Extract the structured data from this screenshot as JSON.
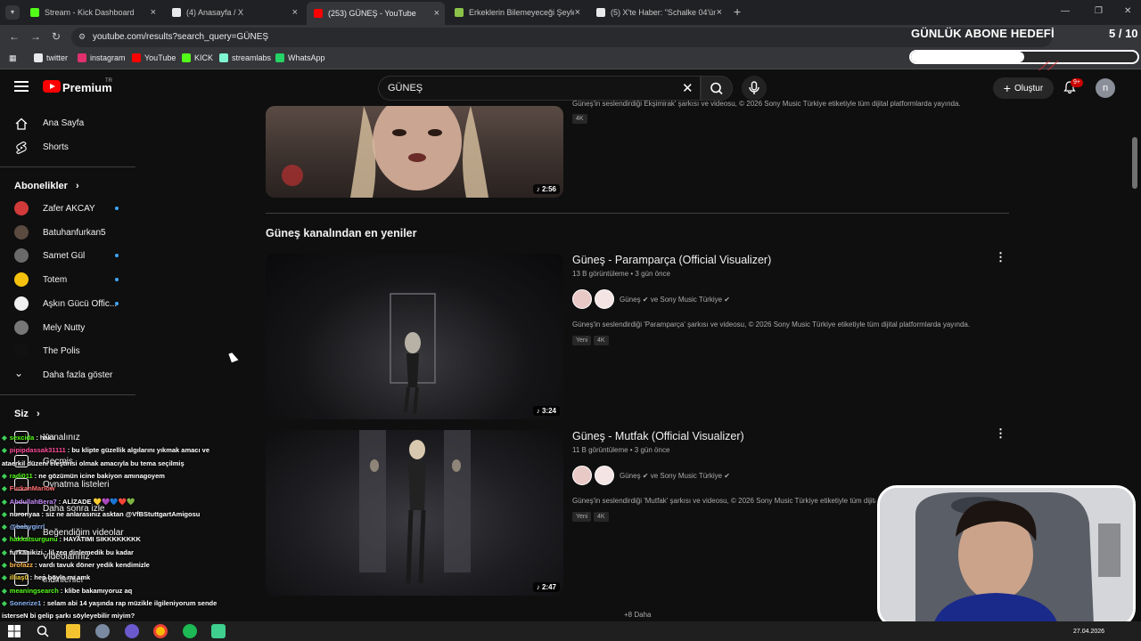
{
  "browser": {
    "tabs": [
      {
        "title": "Stream - Kick Dashboard",
        "favicon_color": "#53fc18",
        "active": false
      },
      {
        "title": "(4) Anasayfa / X",
        "favicon_color": "#e7e9ea",
        "active": false
      },
      {
        "title": "(253) GÜNEŞ - YouTube",
        "favicon_color": "#ff0000",
        "active": true
      },
      {
        "title": "Erkeklerin Bilemeyeceği Şeyler",
        "favicon_color": "#8bc34a",
        "active": false
      },
      {
        "title": "(5) X'te Haber: \"Schalke 04'ün s",
        "favicon_color": "#e7e9ea",
        "active": false
      }
    ],
    "new_tab_label": "+",
    "close_glyph": "×",
    "url": "youtube.com/results?search_query=GÜNEŞ",
    "bookmarks": [
      {
        "label": "twitter",
        "color": "#e7e9ea"
      },
      {
        "label": "instagram",
        "color": "#e1306c"
      },
      {
        "label": "YouTube",
        "color": "#ff0000"
      },
      {
        "label": "KICK",
        "color": "#53fc18"
      },
      {
        "label": "streamlabs",
        "color": "#80f5d2"
      },
      {
        "label": "WhatsApp",
        "color": "#25d366"
      }
    ]
  },
  "overlay": {
    "goal_title": "GÜNLÜK ABONE HEDEFİ",
    "goal_count": "5 / 10",
    "goal_progress": 0.5
  },
  "header": {
    "brand": "Premium",
    "region": "TR",
    "search_value": "GÜNEŞ",
    "create_label": "Oluştur",
    "notifications": "9+",
    "avatar_letter": "n"
  },
  "sidebar": {
    "nav": [
      {
        "label": "Ana Sayfa",
        "icon": "home-icon"
      },
      {
        "label": "Shorts",
        "icon": "shorts-icon"
      }
    ],
    "subs_header": "Abonelikler",
    "subscriptions": [
      {
        "label": "Zafer AKCAY",
        "color": "#d23a3a",
        "live": true
      },
      {
        "label": "Batuhanfurkan5",
        "color": "#5a4a40",
        "live": false
      },
      {
        "label": "Samet Gül",
        "color": "#6a6a6a",
        "live": true
      },
      {
        "label": "Totem",
        "color": "#f4c20d",
        "live": true
      },
      {
        "label": "Aşkın Gücü Offic...",
        "color": "#f0f0f0",
        "live": true
      },
      {
        "label": "Mely Nutty",
        "color": "#777777",
        "live": false
      },
      {
        "label": "The Polis",
        "color": "#111111",
        "live": false
      }
    ],
    "show_more": "Daha fazla göster",
    "you_header": "Siz",
    "you_items": [
      "Kanalınız",
      "Geçmiş",
      "Oynatma listeleri",
      "Daha sonra izle",
      "Beğendiğim videolar",
      "Videolarınız",
      "İndirilenler"
    ]
  },
  "results": {
    "top_card": {
      "duration": "2:56",
      "desc": "Güneş'in seslendirdiği  Ekşimirak' şarkısı ve videosu, © 2026 Sony Music Türkiye etiketiyle tüm dijital platformlarda yayında.",
      "badges": [
        "4K"
      ]
    },
    "section_title": "Güneş kanalından en yeniler",
    "videos": [
      {
        "title": "Güneş - Paramparça (Official Visualizer)",
        "meta": "13 B görüntüleme • 3 gün önce",
        "channel": "Güneş  ✔ ve Sony Music Türkiye ✔",
        "desc": "Güneş'in seslendirdiği 'Paramparça' şarkısı ve videosu, © 2026 Sony Music Türkiye etiketiyle tüm dijital platformlarda yayında.",
        "badges": [
          "Yeni",
          "4K"
        ],
        "duration": "3:24"
      },
      {
        "title": "Güneş - Mutfak (Official Visualizer)",
        "meta": "11 B görüntüleme • 3 gün önce",
        "channel": "Güneş  ✔ ve Sony Music Türkiye ✔",
        "desc": "Güneş'in seslendirdiği 'Mutfak' şarkısı ve videosu, © 2026 Sony Music Türkiye etiketiyle tüm dijital platformlarda yayında.",
        "badges": [
          "Yeni",
          "4K"
        ],
        "duration": "2:47"
      }
    ],
    "more_label": "+8 Daha"
  },
  "chat": [
    {
      "user": "sexcida",
      "user_color": "#53fc18",
      "msg": "haklı"
    },
    {
      "user": "pipipdassak31111",
      "user_color": "#ff4d9a",
      "msg": "bu klipte güzellik algılarını yıkmak amacı ve"
    },
    {
      "user": "",
      "user_color": "#ffffff",
      "msg": "ataerkil düzeni eleştirisi olmak amacıyla bu tema seçilmiş"
    },
    {
      "user": "radi011",
      "user_color": "#53fc18",
      "msg": "ne gözümün icine bakiyon amınagoyem"
    },
    {
      "user": "FurkanMarlow",
      "user_color": "#ff6b6b",
      "msg": ""
    },
    {
      "user": "AbdullahBera7",
      "user_color": "#c58af9",
      "msg": "ALİZADE 💛💜💙❤️💚"
    },
    {
      "user": "nuronyaa",
      "user_color": "#ffffff",
      "msg": "siz ne anlarasınız asktan @VfBStuttgartAmigosu"
    },
    {
      "user": "@babygirrl",
      "user_color": "#8ab4f8",
      "msg": ""
    },
    {
      "user": "hakkatsurgunu",
      "user_color": "#53fc18",
      "msg": "HAYATIMI SIKKKKKKKK"
    },
    {
      "user": "furkanikizi",
      "user_color": "#ffffff",
      "msg": "lil zeq dinlemedik bu kadar"
    },
    {
      "user": "brofazz",
      "user_color": "#ffb74d",
      "msg": "vardı tavuk döner yedik kendimizle"
    },
    {
      "user": "illiaş0",
      "user_color": "#f4d03f",
      "msg": "hep böyle mı amk"
    },
    {
      "user": "meaningsearch",
      "user_color": "#53fc18",
      "msg": "klibe bakamıyoruz aq"
    },
    {
      "user": "Sonerize1",
      "user_color": "#8ab4f8",
      "msg": "selam abi 14 yaşında rap müzikle ilgileniyorum sende"
    },
    {
      "user": "",
      "user_color": "#ffffff",
      "msg": "isterseN bi gelip şarkı söyleyebilir miyim?"
    }
  ],
  "taskbar": {
    "date": "27.04.2026"
  }
}
